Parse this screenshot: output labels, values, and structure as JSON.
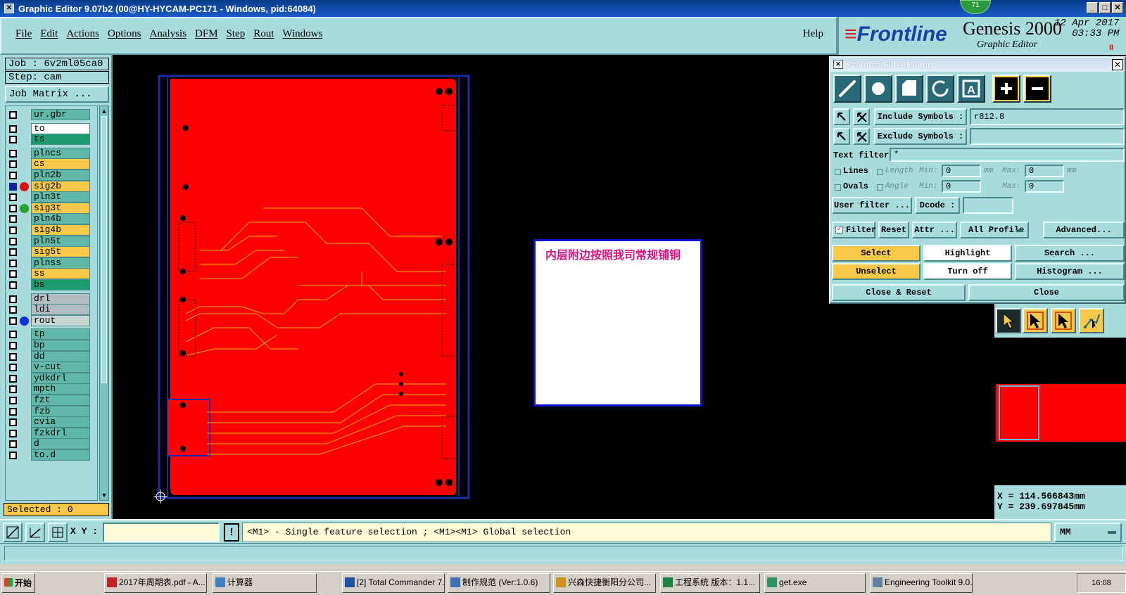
{
  "window": {
    "title": "Graphic Editor 9.07b2 (00@HY-HYCAM-PC171 - Windows, pid:64084)",
    "badge": "71"
  },
  "menu": {
    "items": [
      "File",
      "Edit",
      "Actions",
      "Options",
      "Analysis",
      "DFM",
      "Step",
      "Rout",
      "Windows"
    ],
    "help": "Help"
  },
  "logo": {
    "brand": "Frontline",
    "product": "Genesis 2000",
    "subtitle": "Graphic Editor",
    "date": "12 Apr 2017",
    "time": "03:33 PM",
    "pause": "II"
  },
  "left": {
    "job": "Job : 6v2ml05ca0",
    "step": "Step: cam",
    "job_matrix_btn": "Job Matrix ...",
    "selected": "Selected : 0",
    "layers": [
      {
        "name": "ur.gbr",
        "color": "teal",
        "dot": ""
      },
      {
        "name": "to",
        "color": "white",
        "dot": ""
      },
      {
        "name": "ts",
        "color": "green",
        "dot": ""
      },
      {
        "name": "plncs",
        "color": "teal",
        "dot": ""
      },
      {
        "name": "cs",
        "color": "yellow",
        "dot": ""
      },
      {
        "name": "pln2b",
        "color": "teal",
        "dot": ""
      },
      {
        "name": "sig2b",
        "color": "yellow",
        "dot": "#e01010"
      },
      {
        "name": "pln3t",
        "color": "teal",
        "dot": ""
      },
      {
        "name": "sig3t",
        "color": "yellow",
        "dot": "#2aa030"
      },
      {
        "name": "pln4b",
        "color": "teal",
        "dot": ""
      },
      {
        "name": "sig4b",
        "color": "yellow",
        "dot": ""
      },
      {
        "name": "pln5t",
        "color": "teal",
        "dot": ""
      },
      {
        "name": "sig5t",
        "color": "yellow",
        "dot": ""
      },
      {
        "name": "plnss",
        "color": "teal",
        "dot": ""
      },
      {
        "name": "ss",
        "color": "yellow",
        "dot": ""
      },
      {
        "name": "bs",
        "color": "green",
        "dot": ""
      },
      {
        "name": "drl",
        "color": "grey",
        "dot": ""
      },
      {
        "name": "ldi",
        "color": "grey",
        "dot": ""
      },
      {
        "name": "rout",
        "color": "lgrey",
        "dot": "#1030e0"
      },
      {
        "name": "tp",
        "color": "teal",
        "dot": ""
      },
      {
        "name": "bp",
        "color": "teal",
        "dot": ""
      },
      {
        "name": "dd",
        "color": "teal",
        "dot": ""
      },
      {
        "name": "v-cut",
        "color": "teal",
        "dot": ""
      },
      {
        "name": "ydkdrl",
        "color": "teal",
        "dot": ""
      },
      {
        "name": "mpth",
        "color": "teal",
        "dot": ""
      },
      {
        "name": "fzt",
        "color": "teal",
        "dot": ""
      },
      {
        "name": "fzb",
        "color": "teal",
        "dot": ""
      },
      {
        "name": "cvia",
        "color": "teal",
        "dot": ""
      },
      {
        "name": "fzkdrl",
        "color": "teal",
        "dot": ""
      },
      {
        "name": "d",
        "color": "teal",
        "dot": ""
      },
      {
        "name": "to.d",
        "color": "teal",
        "dot": ""
      }
    ]
  },
  "canvas": {
    "annotation": "内层附边按照我司常规铺铜"
  },
  "filter_popup": {
    "title": "Features Filter Popup",
    "include_label": "Include Symbols :",
    "include_value": "r812.8",
    "exclude_label": "Exclude Symbols :",
    "exclude_value": "",
    "text_filter_label": "Text filter",
    "text_filter_value": "*",
    "lines": "Lines",
    "ovals": "Ovals",
    "length": "Length",
    "angle": "Angle",
    "min": "Min:",
    "max": "Max:",
    "min_value": "0",
    "max_value": "0",
    "unit": "mm",
    "user_filter": "User filter ...",
    "dcode": "Dcode :",
    "filter": "Filter",
    "reset": "Reset",
    "attr": "Attr ...",
    "profile": "All Profile",
    "advanced": "Advanced...",
    "select": "Select",
    "highlight": "Highlight",
    "search": "Search ...",
    "unselect": "Unselect",
    "turn_off": "Turn off",
    "histogram": "Histogram ...",
    "close_reset": "Close & Reset",
    "close": "Close"
  },
  "coords": {
    "x": "X = 114.566843mm",
    "y": "Y = 239.697845mm"
  },
  "status": {
    "xy_label": "X Y :",
    "message": "<M1> - Single feature selection ; <M1><M1> Global selection",
    "units": "MM",
    "bang": "!"
  },
  "taskbar": {
    "start": "开始",
    "tasks": [
      "2017年周期表.pdf - A...",
      "计算器",
      "[2] Total Commander 7...",
      "制作规范 (Ver:1.0.6)",
      "兴森快捷衡阳分公司...",
      "工程系统  版本：1.1...",
      "get.exe",
      "Engineering Toolkit 9.0..."
    ],
    "clock": "16:08"
  }
}
